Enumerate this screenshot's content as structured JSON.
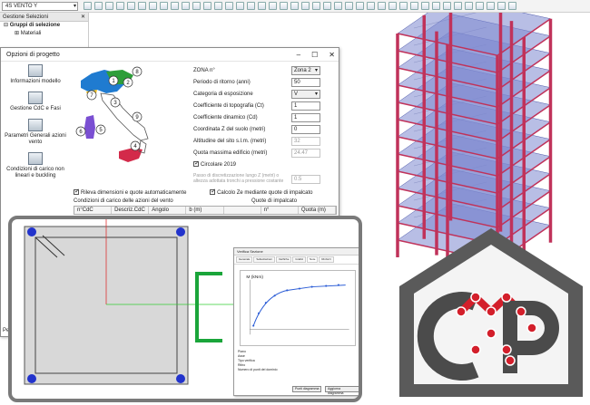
{
  "toolbar": {
    "combo_value": "4S VENTO Y"
  },
  "selection_panel": {
    "title": "Gestione Selezioni",
    "tree": [
      {
        "label": "Gruppi di selezione",
        "bold": true
      },
      {
        "label": "Materiali",
        "bold": false
      }
    ]
  },
  "dialog": {
    "title": "Opzioni di progetto",
    "nav": [
      {
        "label": "Informazioni modello"
      },
      {
        "label": "Gestione CdC e Fasi"
      },
      {
        "label": "Parametri Generali azioni vento"
      },
      {
        "label": "Condizioni di carico non lineari e buckling"
      }
    ],
    "map_zones": [
      "1",
      "2",
      "3",
      "4",
      "5",
      "6",
      "7",
      "8",
      "9"
    ],
    "form": {
      "zona_label": "ZONA n°",
      "zona_value": "Zona 2",
      "periodo_label": "Periodo di ritorno (anni)",
      "periodo_value": "50",
      "categoria_label": "Categoria di esposizione",
      "categoria_value": "V",
      "ct_label": "Coefficiente di topografia (Ct)",
      "ct_value": "1",
      "cd_label": "Coefficiente dinamico (Cd)",
      "cd_value": "1",
      "z_label": "Coordinata Z del suolo (metri)",
      "z_value": "0",
      "altitudine_label": "Altitudine del sito s.l.m. (metri)",
      "altitudine_value": "32",
      "quota_label": "Quota massima edificio (metri)",
      "quota_value": "24.47",
      "circolare_label": "Circolare 2019",
      "passo_label": "Passo di discretizzazione lungo Z (metri) o altezza adottata tronchi a pressione costante",
      "passo_value": "0.5",
      "calcolo_ze_label": "Calcolo Ze mediante quote di impalcato"
    },
    "rileva_label": "Rileva dimensioni e quote automaticamente",
    "condizioni_caption": "Condizioni di carico delle azioni del vento",
    "quote_caption": "Quote di impalcato",
    "table_headers": [
      "n°CdC",
      "Descriz.CdC",
      "Angolo",
      "b (m)",
      "",
      "n°",
      "Quota (m)"
    ]
  },
  "status_text": "Per m",
  "inset": {
    "dialog_title": "Verifica Sezione",
    "tabs": [
      "Generale",
      "Sollecitazioni",
      "Verifiche",
      "Grafici",
      "Note",
      "Rinforzi"
    ],
    "plot_label": "M (kNm)",
    "lower_labels": [
      "Piano",
      "Asse",
      "Tipo verifica",
      "Ritiro",
      "Numero di punti del dominio"
    ],
    "btn_labels": [
      "Punti diagramma",
      "Aggiorna diagramma"
    ]
  },
  "colors": {
    "column": "#c0325a",
    "slab": "#7d88cf",
    "section_bg": "#d8d8d8",
    "rebar": "#2233cc",
    "logo_frame": "#5a5a5a",
    "logo_red": "#d31f2b"
  }
}
